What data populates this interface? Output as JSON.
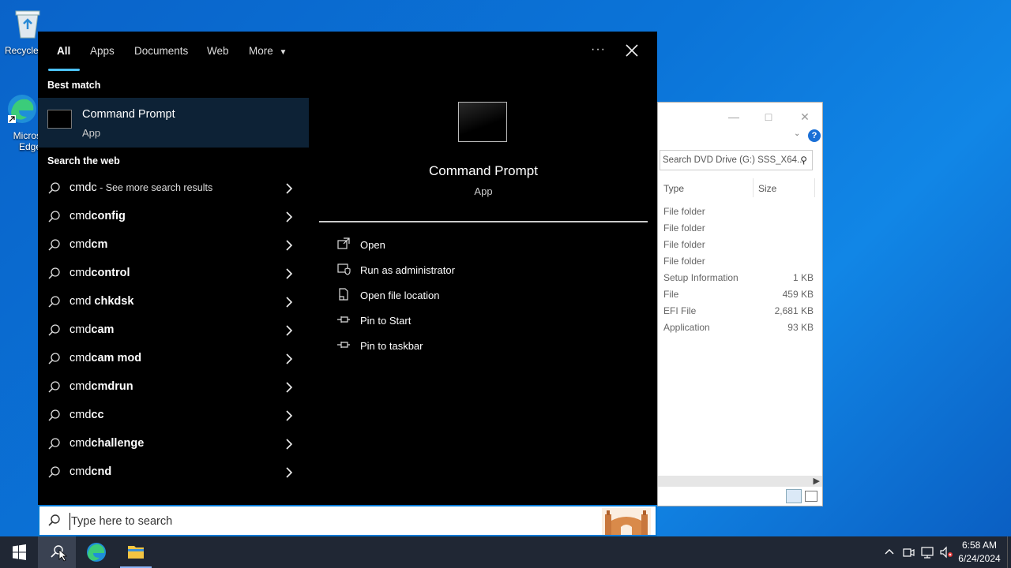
{
  "desktop": {
    "icons": [
      {
        "label": "Recycle"
      },
      {
        "label": "Micros Edge"
      }
    ]
  },
  "explorer": {
    "search_placeholder": "Search DVD Drive (G:) SSS_X64...",
    "col_type": "Type",
    "col_size": "Size",
    "rows": [
      {
        "type": "File folder",
        "size": ""
      },
      {
        "type": "File folder",
        "size": ""
      },
      {
        "type": "File folder",
        "size": ""
      },
      {
        "type": "File folder",
        "size": ""
      },
      {
        "type": "Setup Information",
        "size": "1 KB"
      },
      {
        "type": "File",
        "size": "459 KB"
      },
      {
        "type": "EFI File",
        "size": "2,681 KB"
      },
      {
        "type": "Application",
        "size": "93 KB"
      }
    ]
  },
  "search_panel": {
    "tabs": [
      {
        "label": "All",
        "active": true
      },
      {
        "label": "Apps"
      },
      {
        "label": "Documents"
      },
      {
        "label": "Web"
      },
      {
        "label": "More"
      }
    ],
    "more_options": "···",
    "best_match_heading": "Best match",
    "best_match": {
      "name": "Command Prompt",
      "type": "App"
    },
    "web_heading": "Search the web",
    "web_results": [
      {
        "prefix": "cmdc",
        "suffix": "",
        "extra": " - See more search results"
      },
      {
        "prefix": "cmd",
        "suffix": "config",
        "extra": ""
      },
      {
        "prefix": "cmd",
        "suffix": "cm",
        "extra": ""
      },
      {
        "prefix": "cmd",
        "suffix": "control",
        "extra": ""
      },
      {
        "prefix": "cmd",
        "suffix": " chkdsk",
        "extra": ""
      },
      {
        "prefix": "cmd",
        "suffix": "cam",
        "extra": ""
      },
      {
        "prefix": "cmd",
        "suffix": "cam mod",
        "extra": ""
      },
      {
        "prefix": "cmd",
        "suffix": "cmdrun",
        "extra": ""
      },
      {
        "prefix": "cmd",
        "suffix": "cc",
        "extra": ""
      },
      {
        "prefix": "cmd",
        "suffix": "challenge",
        "extra": ""
      },
      {
        "prefix": "cmd",
        "suffix": "cnd",
        "extra": ""
      }
    ],
    "preview": {
      "name": "Command Prompt",
      "type": "App",
      "actions": [
        {
          "label": "Open",
          "icon": "open-icon"
        },
        {
          "label": "Run as administrator",
          "icon": "shield-icon"
        },
        {
          "label": "Open file location",
          "icon": "file-location-icon"
        },
        {
          "label": "Pin to Start",
          "icon": "pin-icon"
        },
        {
          "label": "Pin to taskbar",
          "icon": "pin-icon"
        }
      ]
    }
  },
  "searchbox": {
    "placeholder": "Type here to search"
  },
  "taskbar": {
    "time": "6:58 AM",
    "date": "6/24/2024"
  }
}
